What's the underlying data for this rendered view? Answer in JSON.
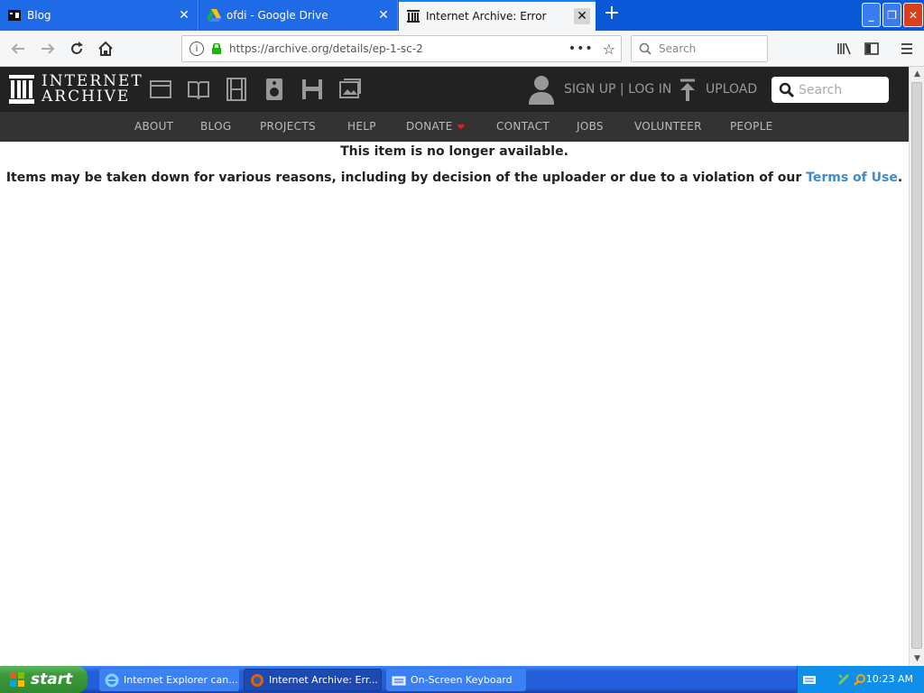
{
  "browser": {
    "tabs": [
      {
        "title": "Blog",
        "icon": "blog-favicon-icon",
        "active": false
      },
      {
        "title": "ofdi - Google Drive",
        "icon": "google-drive-icon",
        "active": false
      },
      {
        "title": "Internet Archive: Error",
        "icon": "internet-archive-icon",
        "active": true
      }
    ],
    "url": "https://archive.org/details/ep-1-sc-2",
    "search_placeholder": "Search"
  },
  "ia_header": {
    "logo_line1": "INTERNET",
    "logo_line2": "ARCHIVE",
    "auth": "SIGN UP | LOG IN",
    "upload": "UPLOAD",
    "search_placeholder": "Search",
    "nav": [
      "ABOUT",
      "BLOG",
      "PROJECTS",
      "HELP",
      "DONATE",
      "CONTACT",
      "JOBS",
      "VOLUNTEER",
      "PEOPLE"
    ]
  },
  "content": {
    "title": "This item is no longer available.",
    "body": "Items may be taken down for various reasons, including by decision of the uploader or due to a violation of our",
    "link": "Terms of Use",
    "period": "."
  },
  "taskbar": {
    "start": "start",
    "tasks": [
      "Internet Explorer can...",
      "Internet Archive: Err...",
      "On-Screen Keyboard"
    ],
    "clock": "10:23 AM"
  },
  "colors": {
    "titlebar": "#0a58d8",
    "ia_header_bg": "#222222",
    "ia_nav_bg": "#333333",
    "link": "#428bca",
    "taskbar": "#245edb",
    "start_green": "#3c9a3c"
  }
}
